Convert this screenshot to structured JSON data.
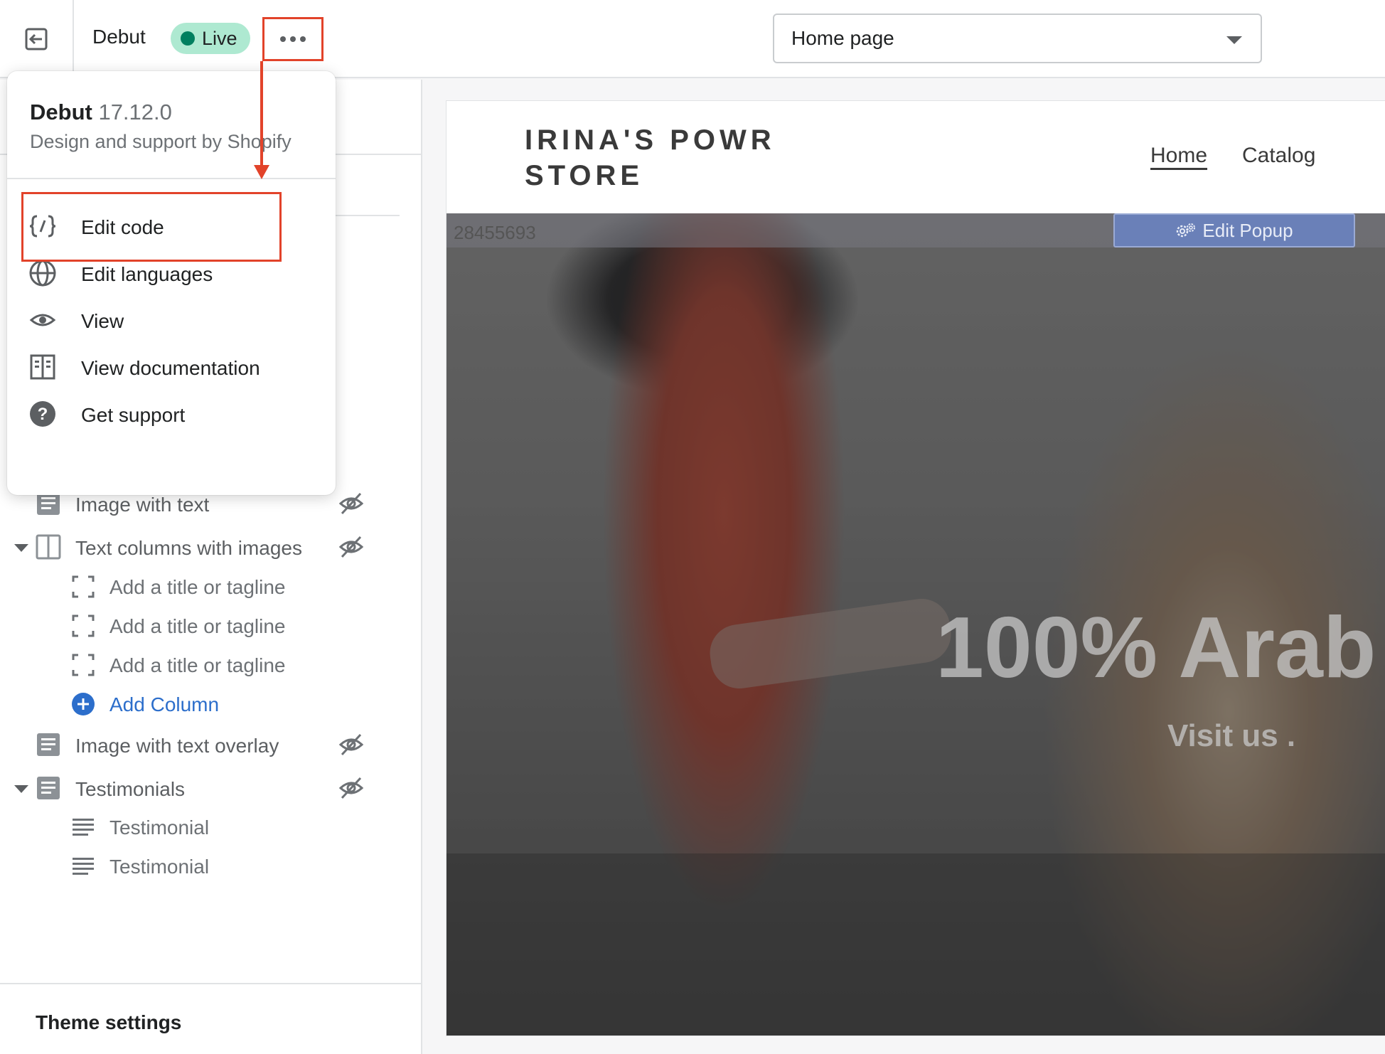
{
  "topbar": {
    "theme_name": "Debut",
    "status_badge": "Live",
    "page_selector_value": "Home page"
  },
  "menu": {
    "theme_name": "Debut",
    "theme_version": "17.12.0",
    "credit": "Design and support by Shopify",
    "items": [
      {
        "label": "Edit code",
        "icon": "code-icon"
      },
      {
        "label": "Edit languages",
        "icon": "globe-icon"
      },
      {
        "label": "View",
        "icon": "eye-icon"
      },
      {
        "label": "View documentation",
        "icon": "book-icon"
      },
      {
        "label": "Get support",
        "icon": "question-icon"
      }
    ]
  },
  "sidebar": {
    "sections": [
      {
        "label": "Image with text",
        "hidden": true,
        "expanded": false
      },
      {
        "label": "Text columns with images",
        "hidden": true,
        "expanded": true,
        "blocks": [
          "Add a title or tagline",
          "Add a title or tagline",
          "Add a title or tagline"
        ],
        "add_label": "Add Column"
      },
      {
        "label": "Image with text overlay",
        "hidden": true,
        "expanded": false
      },
      {
        "label": "Testimonials",
        "hidden": true,
        "expanded": true,
        "blocks": [
          "Testimonial",
          "Testimonial"
        ]
      }
    ],
    "theme_settings": "Theme settings"
  },
  "preview": {
    "store_name": "IRINA'S POWR STORE",
    "nav": [
      "Home",
      "Catalog"
    ],
    "popup_id": "28455693",
    "edit_popup_label": "Edit Popup",
    "hero_title": "100% Arab",
    "hero_subtitle": "Visit us ."
  },
  "colors": {
    "annotation_red": "#e2432a",
    "live_badge_bg": "#aee9d1",
    "live_dot": "#007f5f",
    "link_blue": "#2c6ecb"
  }
}
